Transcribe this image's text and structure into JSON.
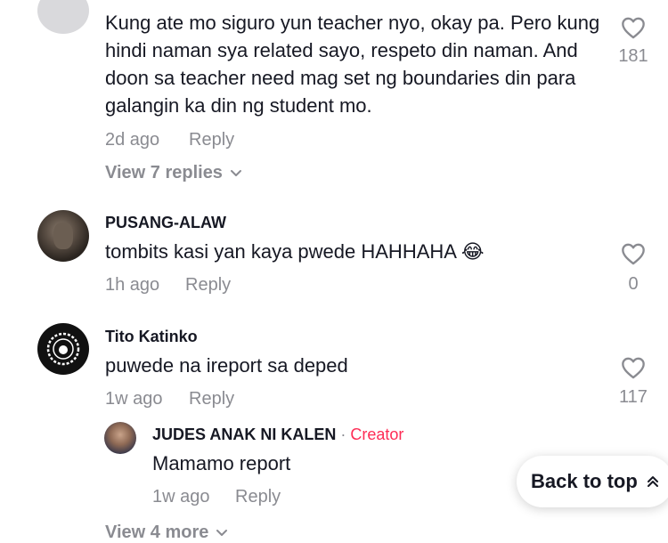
{
  "comments": [
    {
      "text": "Kung ate mo siguro yun teacher nyo, okay pa. Pero kung hindi naman sya related sayo, respeto din naman. And doon sa teacher need mag set ng boundaries din para galangin ka din ng student mo.",
      "time": "2d ago",
      "reply_label": "Reply",
      "likes": "181",
      "view_replies": "View 7 replies"
    },
    {
      "username": "PUSANG-ALAW",
      "text": "tombits kasi yan kaya pwede HAHHAHA 😂",
      "time": "1h ago",
      "reply_label": "Reply",
      "likes": "0"
    },
    {
      "username": "Tito Katinko",
      "text": "puwede na ireport sa deped",
      "time": "1w ago",
      "reply_label": "Reply",
      "likes": "117",
      "reply": {
        "username": "JUDES ANAK NI KALEN",
        "separator": " · ",
        "badge": "Creator",
        "text": "Mamamo report",
        "time": "1w ago",
        "reply_label": "Reply"
      },
      "view_more": "View 4 more"
    }
  ],
  "back_to_top": "Back to top",
  "icons": {
    "heart": "heart-outline-icon",
    "chevron_down": "chevron-down-icon",
    "double_chevron_up": "double-chevron-up-icon"
  },
  "colors": {
    "creator_badge": "#fe2c55",
    "muted": "#8a8b91"
  }
}
